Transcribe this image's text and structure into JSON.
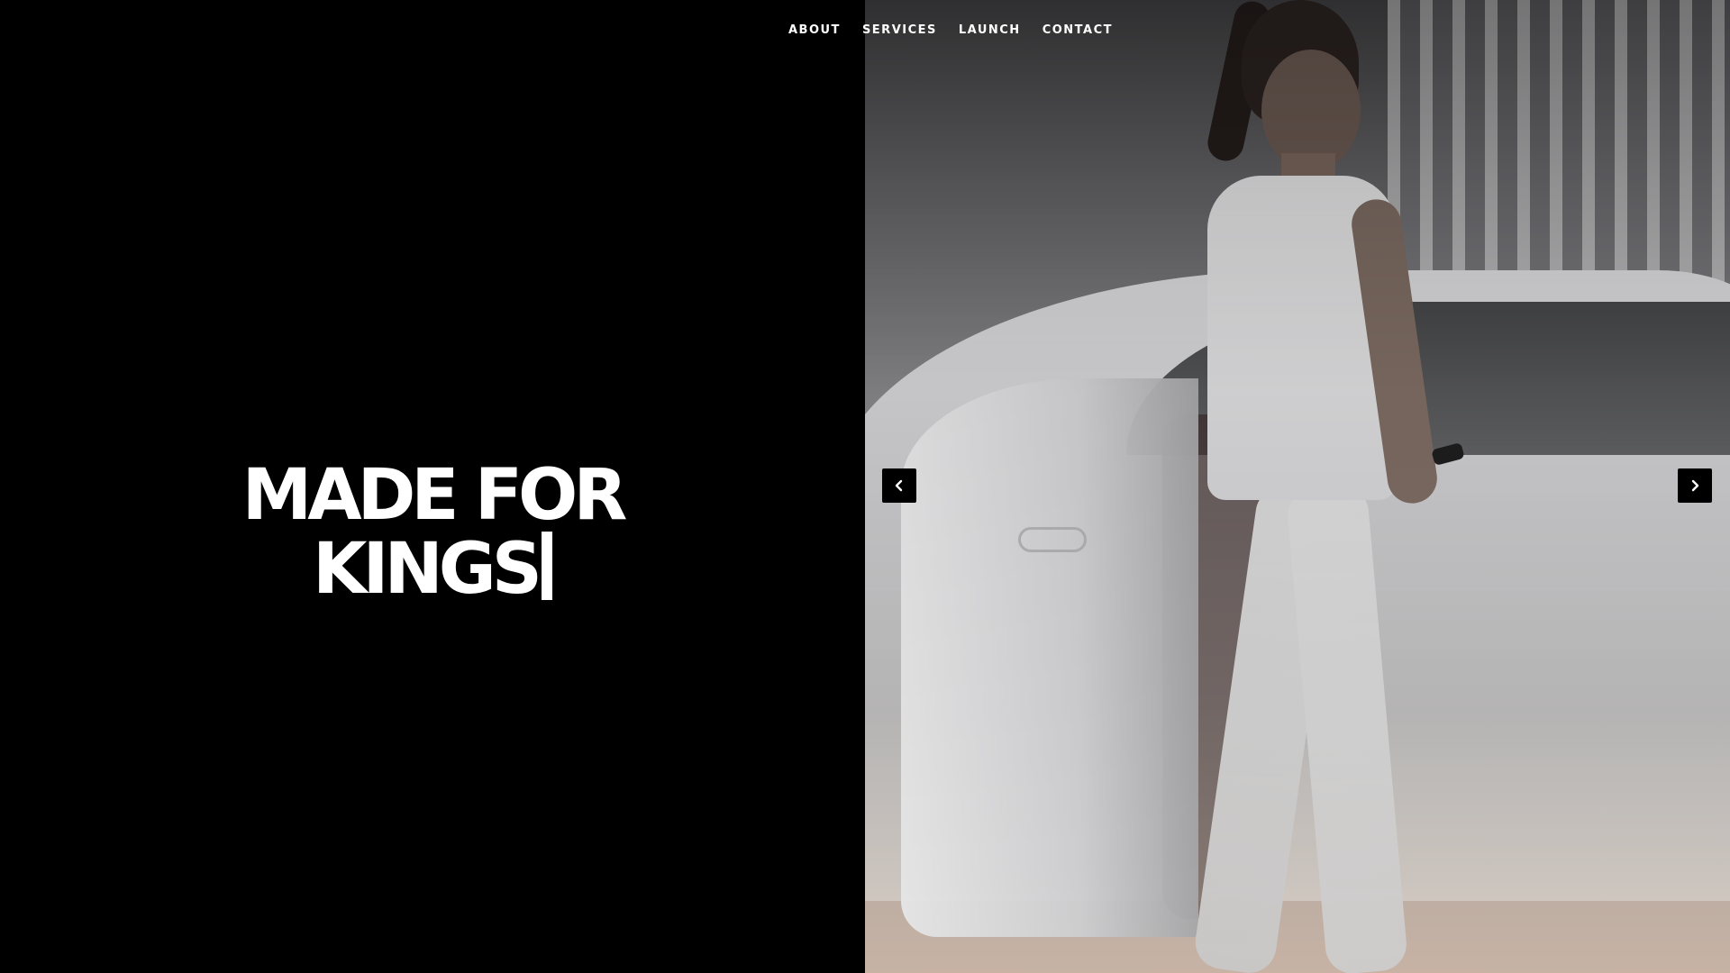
{
  "nav": {
    "items": [
      {
        "label": "ABOUT"
      },
      {
        "label": "SERVICES"
      },
      {
        "label": "LAUNCH"
      },
      {
        "label": "CONTACT"
      }
    ]
  },
  "hero": {
    "headline_line1": "MADE FOR",
    "headline_line2": "KINGS",
    "typing_cursor": "text-cursor"
  },
  "slider": {
    "prev_icon": "chevron-left-icon",
    "next_icon": "chevron-right-icon"
  },
  "colors": {
    "background": "#000000",
    "text": "#ffffff",
    "arrow_bg": "#000000"
  }
}
